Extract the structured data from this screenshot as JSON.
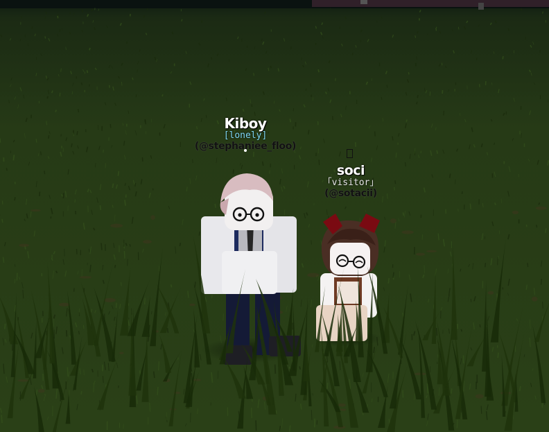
{
  "players": [
    {
      "display_name": "Kiboy",
      "title": "[lonely]",
      "username": "(@stephaniee_floo)"
    },
    {
      "display_name": "soci",
      "title": "「visitor」",
      "username": "(@sotacii)"
    }
  ],
  "icons": {
    "kiboy_marker": "dot-icon",
    "soci_marker": "missing-glyph-icon"
  },
  "colors": {
    "grass_dark": "#1c2c10",
    "grass_mid": "#2c4418",
    "sky": "#0c1410",
    "kiboy_title": "#7fd8f5",
    "soci_title": "#e8e8e8"
  }
}
